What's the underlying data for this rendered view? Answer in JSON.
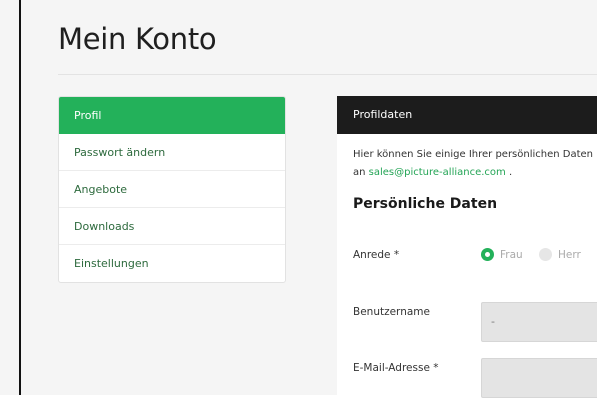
{
  "page": {
    "title": "Mein Konto"
  },
  "sidebar": {
    "items": [
      {
        "label": "Profil",
        "active": true
      },
      {
        "label": "Passwort ändern"
      },
      {
        "label": "Angebote"
      },
      {
        "label": "Downloads"
      },
      {
        "label": "Einstellungen"
      }
    ]
  },
  "panel": {
    "header": "Profildaten",
    "intro_text": "Hier können Sie einige Ihrer persönlichen Daten",
    "intro_prefix": "an ",
    "intro_email": "sales@picture-alliance.com",
    "intro_suffix": " .",
    "section_title": "Persönliche Daten",
    "anrede": {
      "label": "Anrede *",
      "options": [
        {
          "label": "Frau",
          "checked": true
        },
        {
          "label": "Herr",
          "checked": false
        }
      ]
    },
    "benutzername": {
      "label": "Benutzername",
      "value": "-"
    },
    "email": {
      "label": "E-Mail-Adresse *",
      "value": ""
    }
  },
  "colors": {
    "accent": "#23b15a",
    "header_bg": "#1c1c1c",
    "link": "#23a455"
  }
}
